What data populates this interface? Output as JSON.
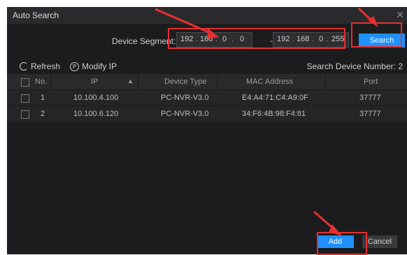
{
  "dialog": {
    "title": "Auto Search"
  },
  "segment": {
    "label": "Device Segment:",
    "start": [
      "192",
      "168",
      "0",
      "0"
    ],
    "end": [
      "192",
      "168",
      "0",
      "255"
    ],
    "dash": "-"
  },
  "buttons": {
    "search": "Search",
    "add": "Add",
    "cancel": "Cancel"
  },
  "toolbar": {
    "refresh": "Refresh",
    "modify_ip": "Modify IP"
  },
  "search_count": {
    "label": "Search Device Number:",
    "value": "2"
  },
  "table": {
    "headers": [
      "No.",
      "IP",
      "Device Type",
      "MAC Address",
      "Port"
    ],
    "rows": [
      {
        "no": "1",
        "ip": "10.100.4.100",
        "type": "PC-NVR-V3.0",
        "mac": "E4:A4:71:C4:A9:0F",
        "port": "37777"
      },
      {
        "no": "2",
        "ip": "10.100.6.120",
        "type": "PC-NVR-V3.0",
        "mac": "34:F6:4B:98:F4:81",
        "port": "37777"
      }
    ]
  },
  "colors": {
    "annotation": "#e53030",
    "accent": "#1e90ff"
  },
  "icons": [
    "refresh-icon",
    "modify-ip-icon",
    "sort-asc-icon",
    "close-icon"
  ]
}
